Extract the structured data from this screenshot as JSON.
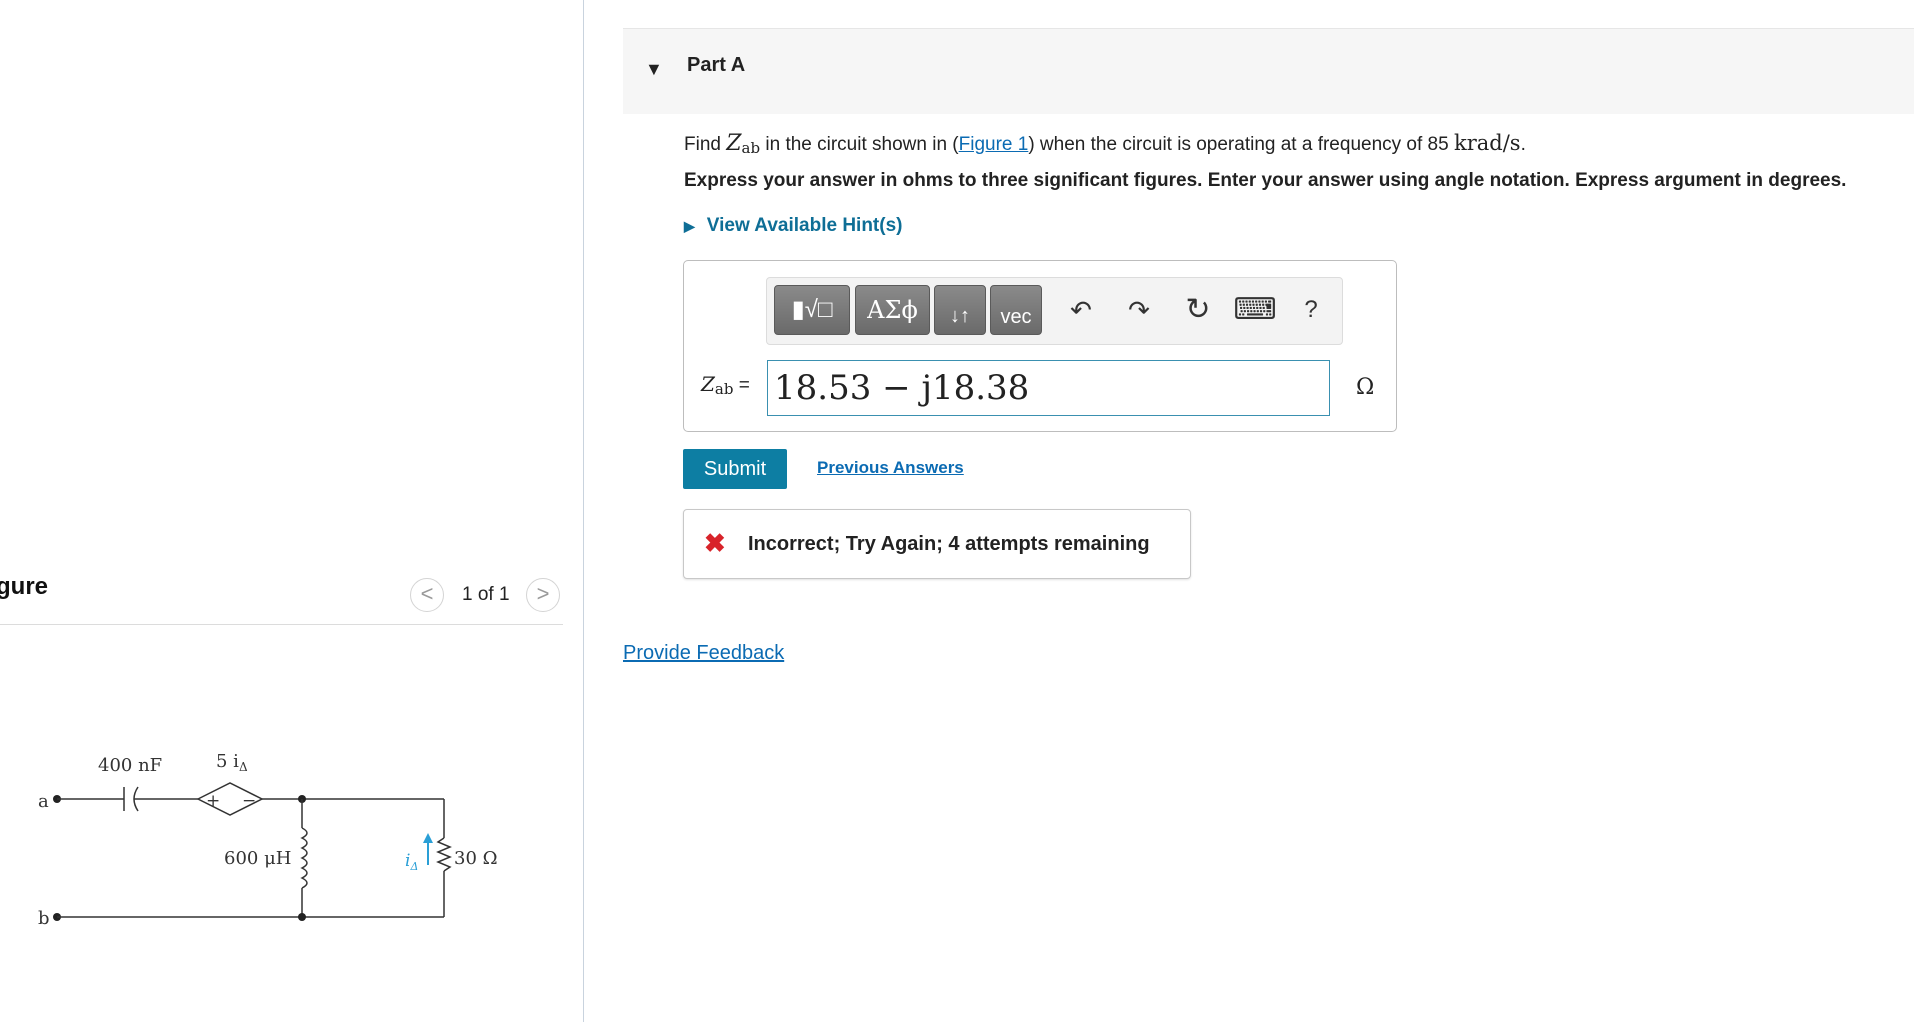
{
  "figure_panel": {
    "title": "gure",
    "counter": "1 of 1",
    "prev_glyph": "<",
    "next_glyph": ">",
    "circuit_labels": {
      "node_a": "a",
      "node_b": "b",
      "capacitor": "400 nF",
      "source": "5 i",
      "source_sub": "Δ",
      "inductor": "600 μH",
      "current": "i",
      "current_sub": "Δ",
      "resistor": "30 Ω",
      "plus": "+",
      "minus": "−"
    }
  },
  "part": {
    "title": "Part A",
    "caret": "▼"
  },
  "question": {
    "prefix": "Find ",
    "var": "Z",
    "var_sub": "ab",
    "mid": " in the circuit shown in (",
    "link": "Figure 1",
    "after_link": ") when the circuit is operating at a frequency of 85 ",
    "unit": "krad/s",
    "end": "."
  },
  "instructions": "Express your answer in ohms to three significant figures. Enter your answer using angle notation. Express argument in degrees.",
  "hint": {
    "label": "View Available Hint(s)",
    "glyph": "▶"
  },
  "toolbar": {
    "templates_label": "▮√□",
    "symbols_label": "ΑΣϕ",
    "arrows_label": "↓↑",
    "vec_label": "vec",
    "undo": "↶",
    "redo": "↷",
    "reset": "↻",
    "keyboard": "⌨",
    "help": "?"
  },
  "answer": {
    "label_var": "Z",
    "label_sub": "ab",
    "label_eq": " =",
    "value": "18.53 − j18.38",
    "unit": "Ω"
  },
  "actions": {
    "submit": "Submit",
    "previous_answers": "Previous Answers"
  },
  "feedback": {
    "icon": "✖",
    "message": "Incorrect; Try Again; 4 attempts remaining"
  },
  "provide_feedback": "Provide Feedback",
  "colors": {
    "accent": "#0d7ea3",
    "link": "#0b6bb3",
    "error": "#d8232a",
    "circuit_current_arrow": "#2a9fd6"
  }
}
